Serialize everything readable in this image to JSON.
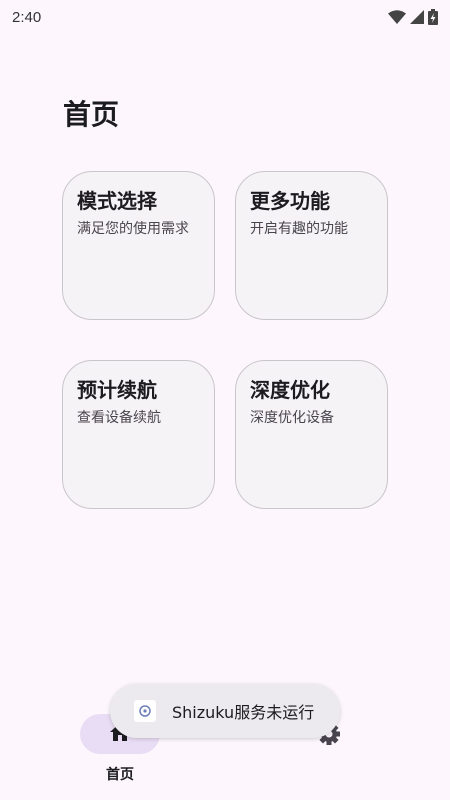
{
  "status_bar": {
    "time": "2:40",
    "icons": [
      "wifi-icon",
      "signal-icon",
      "battery-charging-icon"
    ]
  },
  "page": {
    "title": "首页"
  },
  "cards": [
    {
      "title": "模式选择",
      "subtitle": "满足您的使用需求"
    },
    {
      "title": "更多功能",
      "subtitle": "开启有趣的功能"
    },
    {
      "title": "预计续航",
      "subtitle": "查看设备续航"
    },
    {
      "title": "深度优化",
      "subtitle": "深度优化设备"
    }
  ],
  "bottom_nav": {
    "items": [
      {
        "label": "首页",
        "icon": "home-icon",
        "selected": true
      },
      {
        "label": "",
        "icon": "settings-icon",
        "selected": false
      }
    ],
    "selected_color": "#e9ddf5"
  },
  "toast": {
    "text": "Shizuku服务未运行",
    "icon": "shizuku-app-icon"
  },
  "colors": {
    "background": "#fdf7fd",
    "card_background": "#f6f3f6",
    "card_border": "#c9c6cb"
  }
}
